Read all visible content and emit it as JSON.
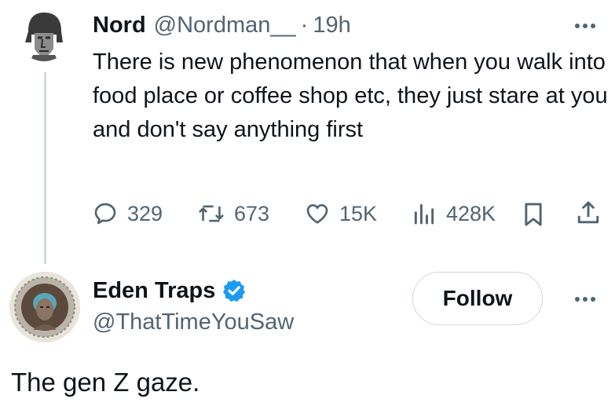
{
  "tweet": {
    "author_name": "Nord",
    "author_handle": "@Nordman__",
    "separator": "·",
    "time": "19h",
    "text": "There is new phenomenon that when you walk into food place or coffee shop etc, they just stare at you and don't say anything first",
    "stats": {
      "replies": "329",
      "retweets": "673",
      "likes": "15K",
      "views": "428K"
    },
    "icons": {
      "more": "more-horizontal-icon",
      "reply": "reply-icon",
      "retweet": "retweet-icon",
      "like": "heart-icon",
      "views": "views-bar-chart-icon",
      "bookmark": "bookmark-icon",
      "share": "share-icon"
    }
  },
  "reply": {
    "author_name": "Eden Traps",
    "author_handle": "@ThatTimeYouSaw",
    "verified": true,
    "follow_label": "Follow",
    "text": "The gen Z gaze."
  },
  "colors": {
    "text": "#0f1419",
    "secondary": "#536471",
    "verified_blue": "#1d9bf0",
    "border": "#cfd9de"
  }
}
